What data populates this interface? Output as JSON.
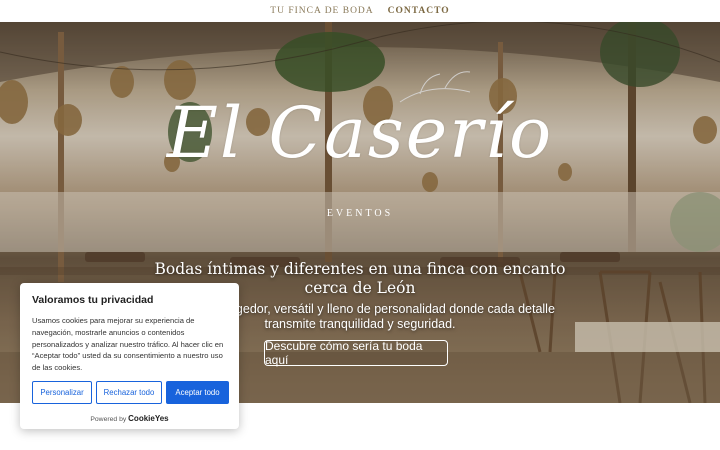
{
  "nav": {
    "items": [
      {
        "label": "TU FINCA DE BODA",
        "active": false
      },
      {
        "label": "CONTACTO",
        "active": true
      }
    ]
  },
  "hero": {
    "logo_script": "El Caserío",
    "logo_sub": "EVENTOS",
    "headline": "Bodas íntimas y diferentes en una finca con encanto cerca de León",
    "description": "Un lugar acogedor, versátil y lleno de personalidad donde cada detalle transmite tranquilidad y seguridad.",
    "cta_label": "Descubre cómo sería tu boda aquí"
  },
  "cookie_banner": {
    "title": "Valoramos tu privacidad",
    "body": "Usamos cookies para mejorar su experiencia de navegación, mostrarle anuncios o contenidos personalizados y analizar nuestro tráfico. Al hacer clic en “Aceptar todo” usted da su consentimiento a nuestro uso de las cookies.",
    "buttons": {
      "customize": "Personalizar",
      "reject": "Rechazar todo",
      "accept": "Aceptar todo"
    },
    "powered_by": "Powered by",
    "brand": "CookieYes"
  },
  "colors": {
    "accent": "#1863dc",
    "nav_text": "#8a7a5a"
  }
}
